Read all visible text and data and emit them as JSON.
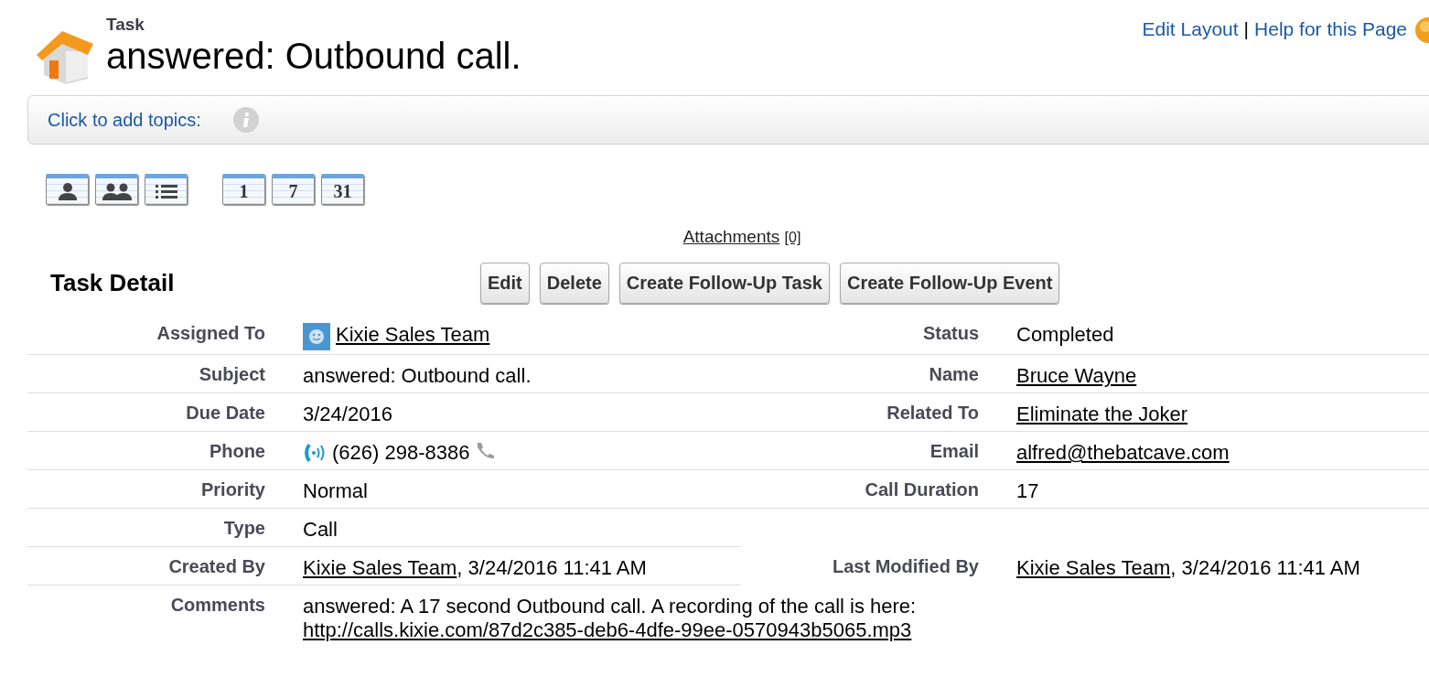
{
  "header": {
    "type_label": "Task",
    "title": "answered: Outbound call.",
    "links": [
      "Edit Layout",
      "Help for this Page"
    ],
    "separator": "|"
  },
  "topics": {
    "prompt": "Click to add topics:"
  },
  "toolbar": [
    {
      "kind": "person"
    },
    {
      "kind": "people"
    },
    {
      "kind": "list"
    },
    {
      "kind": "day",
      "label": "1"
    },
    {
      "kind": "day",
      "label": "7"
    },
    {
      "kind": "day",
      "label": "31"
    }
  ],
  "attachments": {
    "label": "Attachments",
    "count": "[0]"
  },
  "detail": {
    "title": "Task Detail",
    "buttons": [
      "Edit",
      "Delete",
      "Create Follow-Up Task",
      "Create Follow-Up Event"
    ],
    "rows": [
      {
        "left": {
          "label": "Assigned To",
          "kind": "user",
          "value": [
            {
              "text": "Kixie Sales Team",
              "link": true
            }
          ]
        },
        "right": {
          "label": "Status",
          "value": [
            {
              "text": "Completed",
              "link": false
            }
          ]
        }
      },
      {
        "left": {
          "label": "Subject",
          "value": [
            {
              "text": "answered: Outbound call.",
              "link": false
            }
          ]
        },
        "right": {
          "label": "Name",
          "value": [
            {
              "text": "Bruce Wayne",
              "link": true
            }
          ]
        }
      },
      {
        "left": {
          "label": "Due Date",
          "value": [
            {
              "text": "3/24/2016",
              "link": false
            }
          ]
        },
        "right": {
          "label": "Related To",
          "value": [
            {
              "text": "Eliminate the Joker",
              "link": true
            }
          ]
        }
      },
      {
        "left": {
          "label": "Phone",
          "kind": "phone",
          "value": [
            {
              "text": "(626) 298-8386",
              "link": false
            }
          ]
        },
        "right": {
          "label": "Email",
          "value": [
            {
              "text": "alfred@thebatcave.com",
              "link": true
            }
          ]
        }
      },
      {
        "left": {
          "label": "Priority",
          "value": [
            {
              "text": "Normal",
              "link": false
            }
          ]
        },
        "right": {
          "label": "Call Duration",
          "value": [
            {
              "text": "17",
              "link": false
            }
          ]
        }
      },
      {
        "left": {
          "label": "Type",
          "value": [
            {
              "text": "Call",
              "link": false
            }
          ]
        }
      },
      {
        "left": {
          "label": "Created By",
          "value": [
            {
              "text": "Kixie Sales Team",
              "link": true
            },
            {
              "text": ", 3/24/2016 11:41 AM",
              "link": false
            }
          ]
        },
        "right": {
          "label": "Last Modified By",
          "value": [
            {
              "text": "Kixie Sales Team",
              "link": true
            },
            {
              "text": ", 3/24/2016 11:41 AM",
              "link": false
            }
          ]
        }
      },
      {
        "full": {
          "label": "Comments",
          "value": [
            {
              "text": "answered: A 17 second Outbound call. A recording of the call is here: ",
              "link": false
            },
            {
              "text": "http://calls.kixie.com/87d2c385-deb6-4dfe-99ee-0570943b5065.mp3",
              "link": true
            }
          ]
        }
      }
    ]
  }
}
